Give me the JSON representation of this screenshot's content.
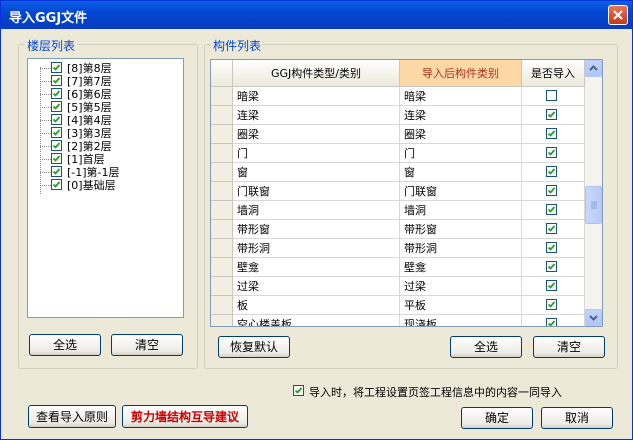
{
  "window": {
    "title": "导入GGJ文件"
  },
  "floors": {
    "legend": "楼层列表",
    "items": [
      {
        "label": "[8]第8层",
        "checked": true
      },
      {
        "label": "[7]第7层",
        "checked": true
      },
      {
        "label": "[6]第6层",
        "checked": true
      },
      {
        "label": "[5]第5层",
        "checked": true
      },
      {
        "label": "[4]第4层",
        "checked": true
      },
      {
        "label": "[3]第3层",
        "checked": true
      },
      {
        "label": "[2]第2层",
        "checked": true
      },
      {
        "label": "[1]首层",
        "checked": true
      },
      {
        "label": "[-1]第-1层",
        "checked": true
      },
      {
        "label": "[0]基础层",
        "checked": true
      }
    ],
    "select_all": "全选",
    "clear": "清空"
  },
  "components": {
    "legend": "构件列表",
    "columns": [
      "GGJ构件类型/类别",
      "导入后构件类别",
      "是否导入"
    ],
    "rows": [
      {
        "source": "暗梁",
        "target": "暗梁",
        "import": false
      },
      {
        "source": "连梁",
        "target": "连梁",
        "import": true
      },
      {
        "source": "圈梁",
        "target": "圈梁",
        "import": true
      },
      {
        "source": "门",
        "target": "门",
        "import": true
      },
      {
        "source": "窗",
        "target": "窗",
        "import": true
      },
      {
        "source": "门联窗",
        "target": "门联窗",
        "import": true
      },
      {
        "source": "墙洞",
        "target": "墙洞",
        "import": true
      },
      {
        "source": "带形窗",
        "target": "带形窗",
        "import": true
      },
      {
        "source": "带形洞",
        "target": "带形洞",
        "import": true
      },
      {
        "source": "壁龛",
        "target": "壁龛",
        "import": true
      },
      {
        "source": "过梁",
        "target": "过梁",
        "import": true
      },
      {
        "source": "板",
        "target": "平板",
        "import": true
      },
      {
        "source": "空心楼盖板",
        "target": "现浇板",
        "import": true
      }
    ],
    "restore_default": "恢复默认",
    "select_all": "全选",
    "clear": "清空"
  },
  "import_project_info": {
    "label": "导入时，将工程设置页签工程信息中的内容一同导入",
    "checked": true
  },
  "footer": {
    "view_principles": "查看导入原则",
    "shear_wall_advice": "剪力墙结构互导建议",
    "ok": "确定",
    "cancel": "取消"
  },
  "colors": {
    "title_bar": "#0347d3",
    "accent_header": "#fbd8a5",
    "legend_text": "#0046d5",
    "check": "#21a121"
  }
}
